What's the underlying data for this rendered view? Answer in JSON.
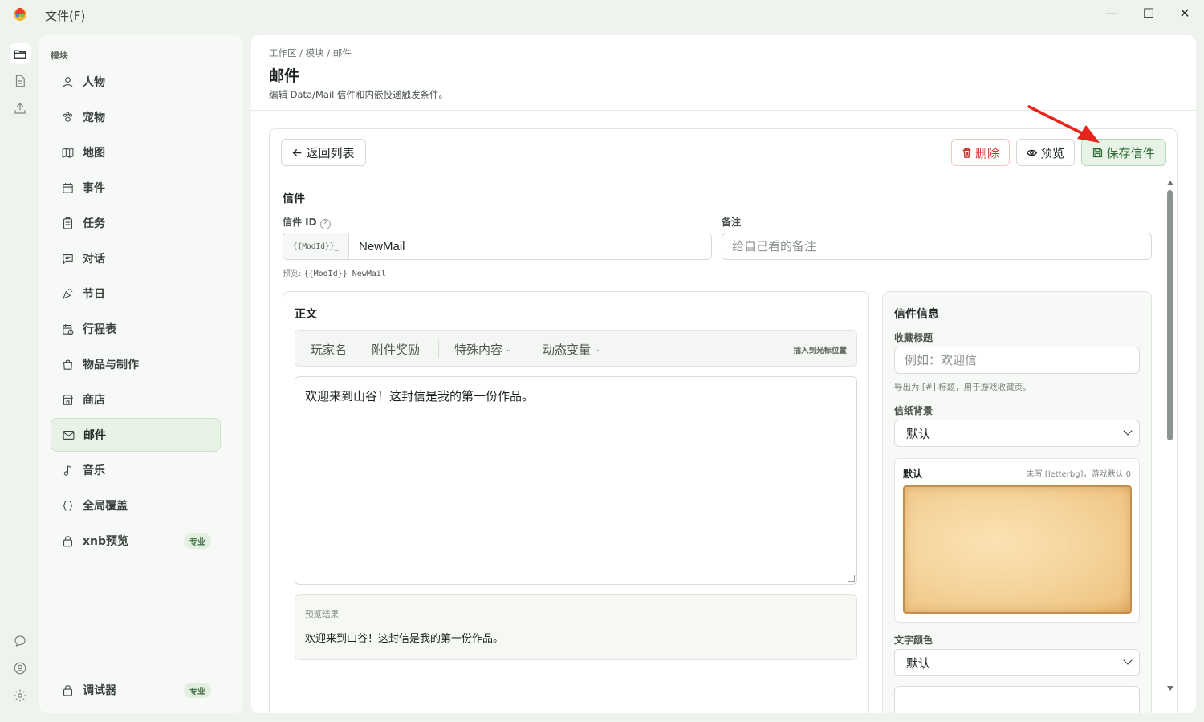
{
  "titlebar": {
    "file_menu": "文件(F)",
    "min_glyph": "—",
    "max_glyph": "☐",
    "close_glyph": "✕"
  },
  "rail": {
    "icons": [
      "folder-icon",
      "document-icon",
      "upload-icon",
      "chat-icon",
      "user-circle-icon",
      "gear-icon"
    ]
  },
  "sidebar": {
    "section": "模块",
    "items": [
      {
        "label": "人物",
        "icon": "person-icon"
      },
      {
        "label": "宠物",
        "icon": "paw-icon"
      },
      {
        "label": "地图",
        "icon": "map-icon"
      },
      {
        "label": "事件",
        "icon": "calendar-icon"
      },
      {
        "label": "任务",
        "icon": "clipboard-icon"
      },
      {
        "label": "对话",
        "icon": "message-icon"
      },
      {
        "label": "节日",
        "icon": "party-icon"
      },
      {
        "label": "行程表",
        "icon": "schedule-icon"
      },
      {
        "label": "物品与制作",
        "icon": "bag-icon"
      },
      {
        "label": "商店",
        "icon": "store-icon"
      },
      {
        "label": "邮件",
        "icon": "mail-icon",
        "active": true
      },
      {
        "label": "音乐",
        "icon": "music-icon"
      },
      {
        "label": "全局覆盖",
        "icon": "braces-icon"
      },
      {
        "label": "xnb预览",
        "icon": "lock-icon",
        "badge": "专业"
      }
    ],
    "bottom_item": {
      "label": "调试器",
      "icon": "lock-icon",
      "badge": "专业"
    }
  },
  "header": {
    "breadcrumb": "工作区 / 模块 / 邮件",
    "title": "邮件",
    "subtitle": "编辑 Data/Mail 信件和内嵌投递触发条件。"
  },
  "toolbar": {
    "back_label": "返回列表",
    "delete_label": "删除",
    "preview_label": "预览",
    "save_label": "保存信件"
  },
  "letter": {
    "section_title": "信件",
    "id_label": "信件 ID",
    "id_help": "?",
    "id_prefix": "{{ModId}}_",
    "id_value": "NewMail",
    "id_preview_label": "预览:",
    "id_preview_value": "{{ModId}}_NewMail",
    "note_label": "备注",
    "note_placeholder": "给自己看的备注"
  },
  "body": {
    "title": "正文",
    "insert_items": [
      "玩家名",
      "附件奖励",
      "特殊内容",
      "动态变量"
    ],
    "insert_hint": "插入到光标位置",
    "text": "欢迎来到山谷！这封信是我的第一份作品。",
    "preview_label": "预览结果",
    "preview_text": "欢迎来到山谷！这封信是我的第一份作品。"
  },
  "info": {
    "title": "信件信息",
    "fav_label": "收藏标题",
    "fav_placeholder": "例如：欢迎信",
    "fav_hint": "导出为 [#] 标题，用于游戏收藏页。",
    "paper_label": "信纸背景",
    "paper_value": "默认",
    "paper_card_name": "默认",
    "paper_card_note": "未写 [letterbg]，游戏默认 0",
    "color_label": "文字颜色",
    "color_value": "默认"
  },
  "colors": {
    "accent": "#2d6b33",
    "danger": "#c3362b",
    "annotation_arrow": "#e8231b"
  }
}
